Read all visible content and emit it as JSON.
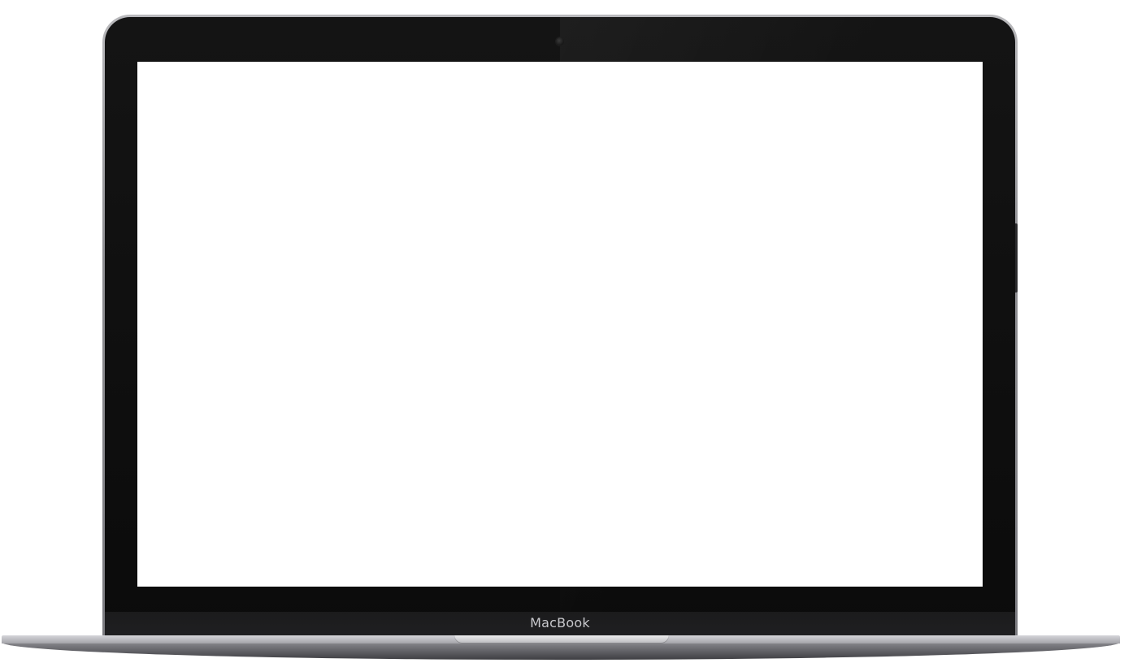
{
  "device": {
    "brand_label": "MacBook",
    "screen_color": "#ffffff",
    "bezel_color": "#0e0e0e",
    "body_color": "#8e8e92"
  },
  "icons": {
    "camera": "camera-icon"
  }
}
